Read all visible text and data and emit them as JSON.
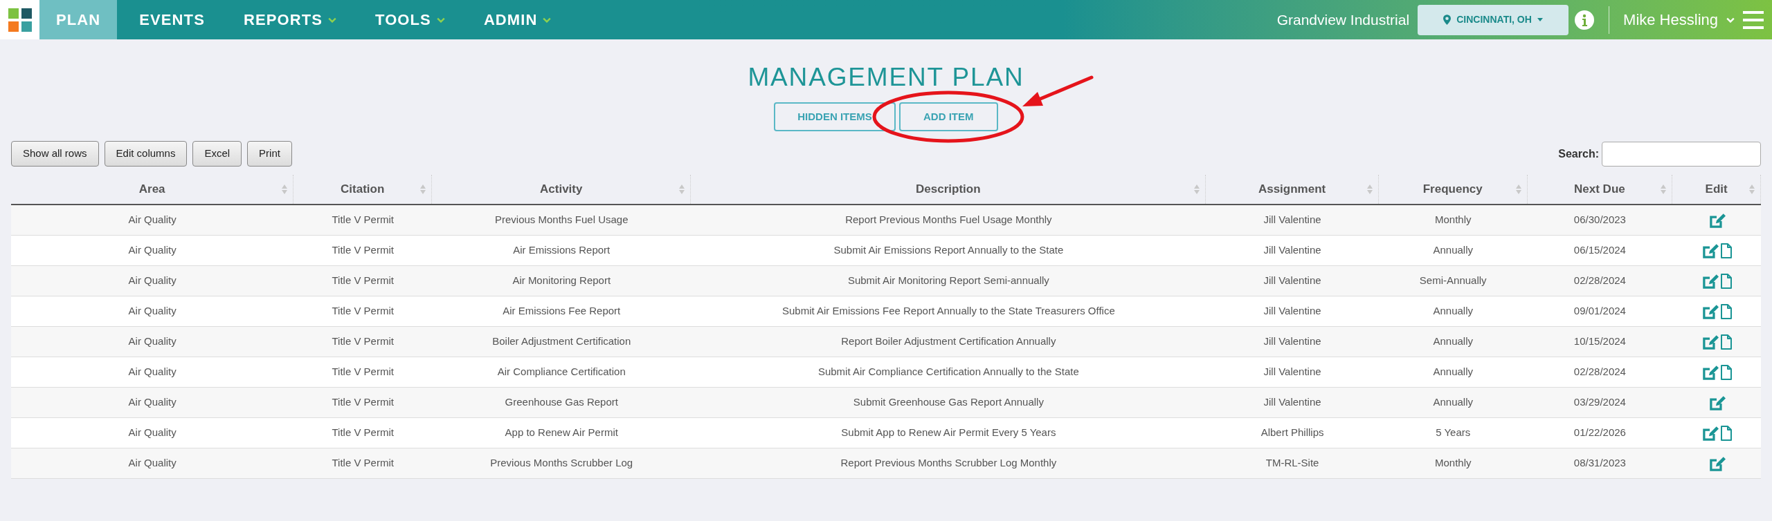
{
  "nav": {
    "items": [
      {
        "label": "PLAN",
        "selected": true,
        "has_menu": false
      },
      {
        "label": "EVENTS",
        "selected": false,
        "has_menu": false
      },
      {
        "label": "REPORTS",
        "selected": false,
        "has_menu": true
      },
      {
        "label": "TOOLS",
        "selected": false,
        "has_menu": true
      },
      {
        "label": "ADMIN",
        "selected": false,
        "has_menu": true
      }
    ],
    "company": "Grandview Industrial",
    "location": "CINCINNATI, OH",
    "user": "Mike Hessling"
  },
  "title": "MANAGEMENT PLAN",
  "actions": [
    {
      "label": "HIDDEN ITEMS",
      "circled": false
    },
    {
      "label": "ADD ITEM",
      "circled": true
    }
  ],
  "toolbar": [
    "Show all rows",
    "Edit columns",
    "Excel",
    "Print"
  ],
  "search": {
    "label": "Search:"
  },
  "table": {
    "columns": [
      "Area",
      "Citation",
      "Activity",
      "Description",
      "Assignment",
      "Frequency",
      "Next Due",
      "Edit"
    ],
    "rows": [
      {
        "cells": [
          "Air Quality",
          "Title V Permit",
          "Previous Months Fuel Usage",
          "Report Previous Months Fuel Usage Monthly",
          "Jill Valentine",
          "Monthly",
          "06/30/2023"
        ],
        "has_document": false
      },
      {
        "cells": [
          "Air Quality",
          "Title V Permit",
          "Air Emissions Report",
          "Submit Air Emissions Report Annually to the State",
          "Jill Valentine",
          "Annually",
          "06/15/2024"
        ],
        "has_document": true
      },
      {
        "cells": [
          "Air Quality",
          "Title V Permit",
          "Air Monitoring Report",
          "Submit Air Monitoring Report Semi-annually",
          "Jill Valentine",
          "Semi-Annually",
          "02/28/2024"
        ],
        "has_document": true
      },
      {
        "cells": [
          "Air Quality",
          "Title V Permit",
          "Air Emissions Fee Report",
          "Submit Air Emissions Fee Report Annually to the State Treasurers Office",
          "Jill Valentine",
          "Annually",
          "09/01/2024"
        ],
        "has_document": true
      },
      {
        "cells": [
          "Air Quality",
          "Title V Permit",
          "Boiler Adjustment Certification",
          "Report Boiler Adjustment Certification Annually",
          "Jill Valentine",
          "Annually",
          "10/15/2024"
        ],
        "has_document": true
      },
      {
        "cells": [
          "Air Quality",
          "Title V Permit",
          "Air Compliance Certification",
          "Submit Air Compliance Certification Annually to the State",
          "Jill Valentine",
          "Annually",
          "02/28/2024"
        ],
        "has_document": true
      },
      {
        "cells": [
          "Air Quality",
          "Title V Permit",
          "Greenhouse Gas Report",
          "Submit Greenhouse Gas Report Annually",
          "Jill Valentine",
          "Annually",
          "03/29/2024"
        ],
        "has_document": false
      },
      {
        "cells": [
          "Air Quality",
          "Title V Permit",
          "App to Renew Air Permit",
          "Submit App to Renew Air Permit Every 5 Years",
          "Albert Phillips",
          "5 Years",
          "01/22/2026"
        ],
        "has_document": true
      },
      {
        "cells": [
          "Air Quality",
          "Title V Permit",
          "Previous Months Scrubber Log",
          "Report Previous Months Scrubber Log Monthly",
          "TM-RL-Site",
          "Monthly",
          "08/31/2023"
        ],
        "has_document": false
      }
    ]
  }
}
